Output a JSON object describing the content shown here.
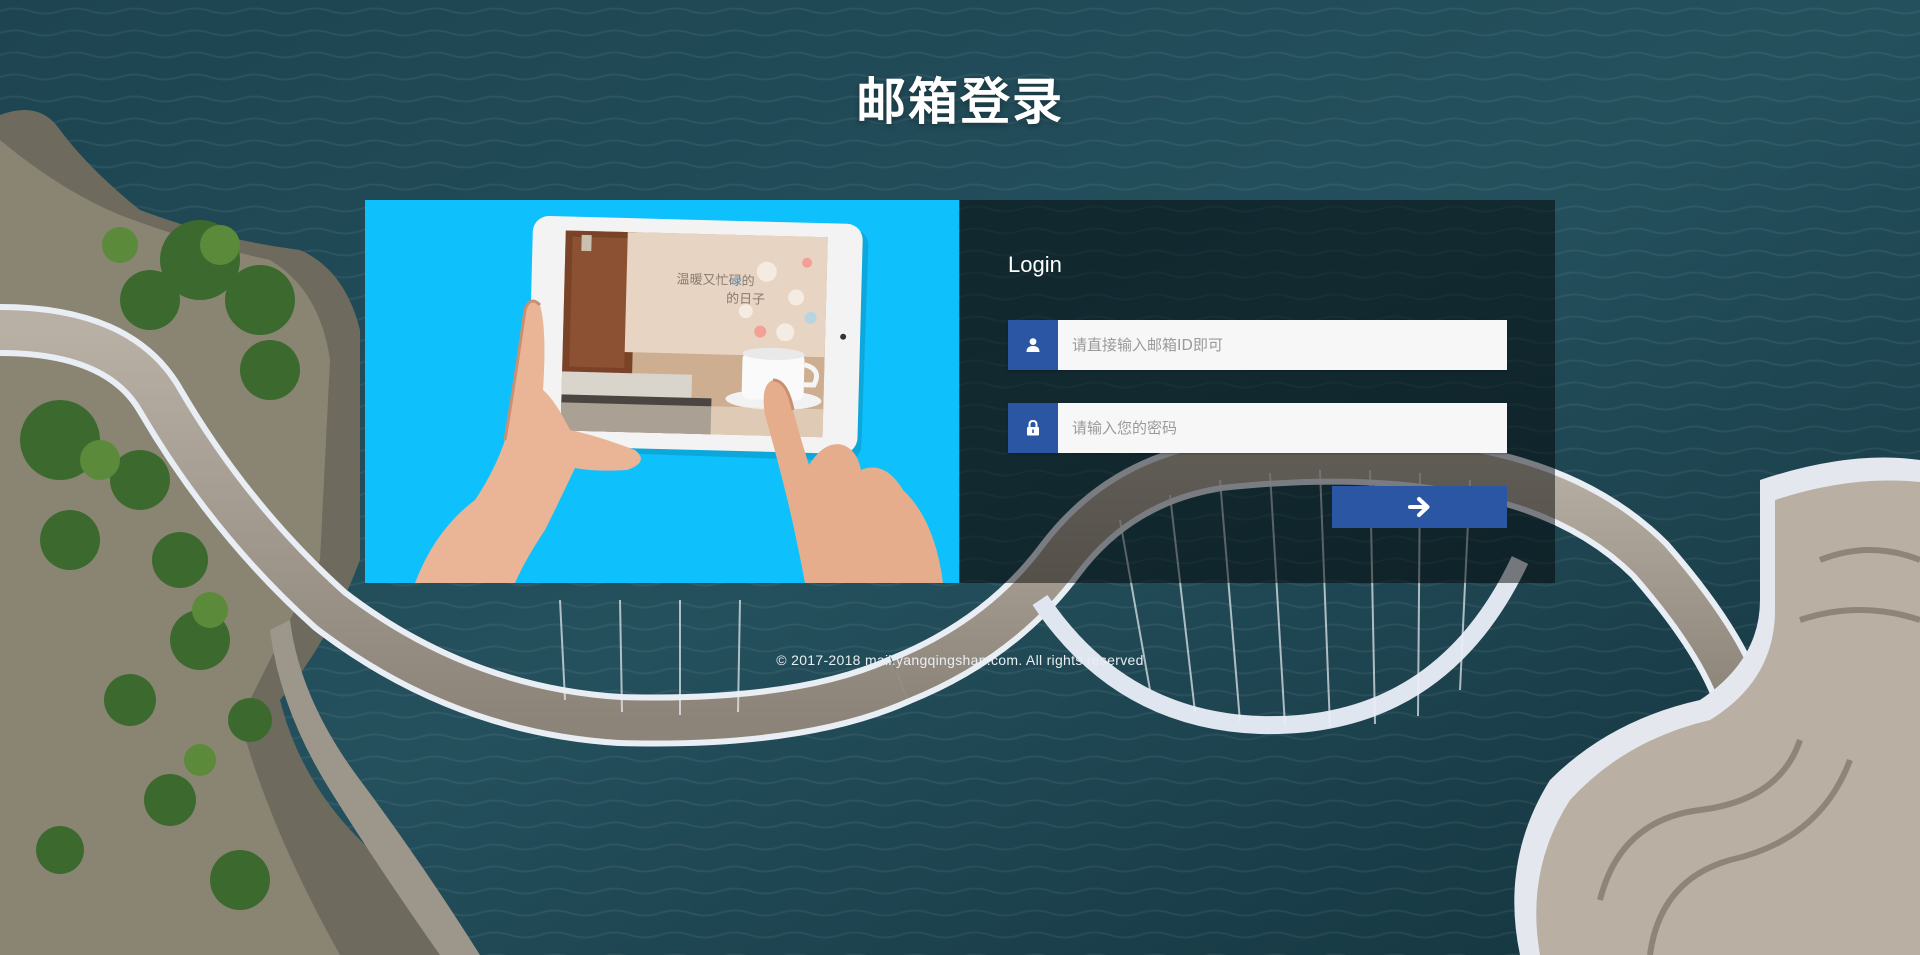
{
  "page": {
    "title": "邮箱登录"
  },
  "login": {
    "heading": "Login",
    "email_placeholder": "请直接输入邮箱ID即可",
    "email_value": "",
    "password_placeholder": "请输入您的密码",
    "password_value": "",
    "email_icon": "user-icon",
    "password_icon": "lock-icon",
    "submit_icon": "arrow-right-icon"
  },
  "promo": {
    "caption_line1": "温暖又忙碌的",
    "caption_line2": "的日子"
  },
  "footer": {
    "copyright": "© 2017-2018 mail.yangqingshan.com. All rights reserved"
  },
  "colors": {
    "accent": "#2b56a4",
    "promo_background": "#0ec0fb",
    "panel_overlay": "rgba(0,0,0,0.48)",
    "title_text": "#ffffff"
  }
}
